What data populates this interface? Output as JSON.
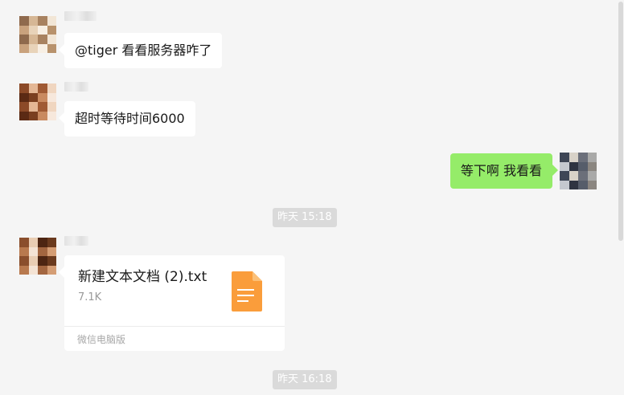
{
  "messages": [
    {
      "type": "text",
      "side": "left",
      "sender": "tiger-like blurred name",
      "text": "@tiger 看看服务器咋了"
    },
    {
      "type": "text",
      "side": "left",
      "sender": "blurred name",
      "text": "超时等待时间6000"
    },
    {
      "type": "text",
      "side": "right",
      "text": "等下啊 我看看"
    },
    {
      "type": "timestamp",
      "text": "昨天 15:18"
    },
    {
      "type": "file",
      "side": "left",
      "sender": "blurred name",
      "file_name": "新建文本文档 (2).txt",
      "file_size": "7.1K",
      "source": "微信电脑版",
      "icon": "document-icon",
      "icon_color": "#fa9d3b"
    },
    {
      "type": "timestamp",
      "text": "昨天 16:18"
    }
  ],
  "colors": {
    "background": "#f5f5f5",
    "sent_bubble": "#95ec69",
    "received_bubble": "#ffffff",
    "timestamp_bg": "#dadada"
  }
}
